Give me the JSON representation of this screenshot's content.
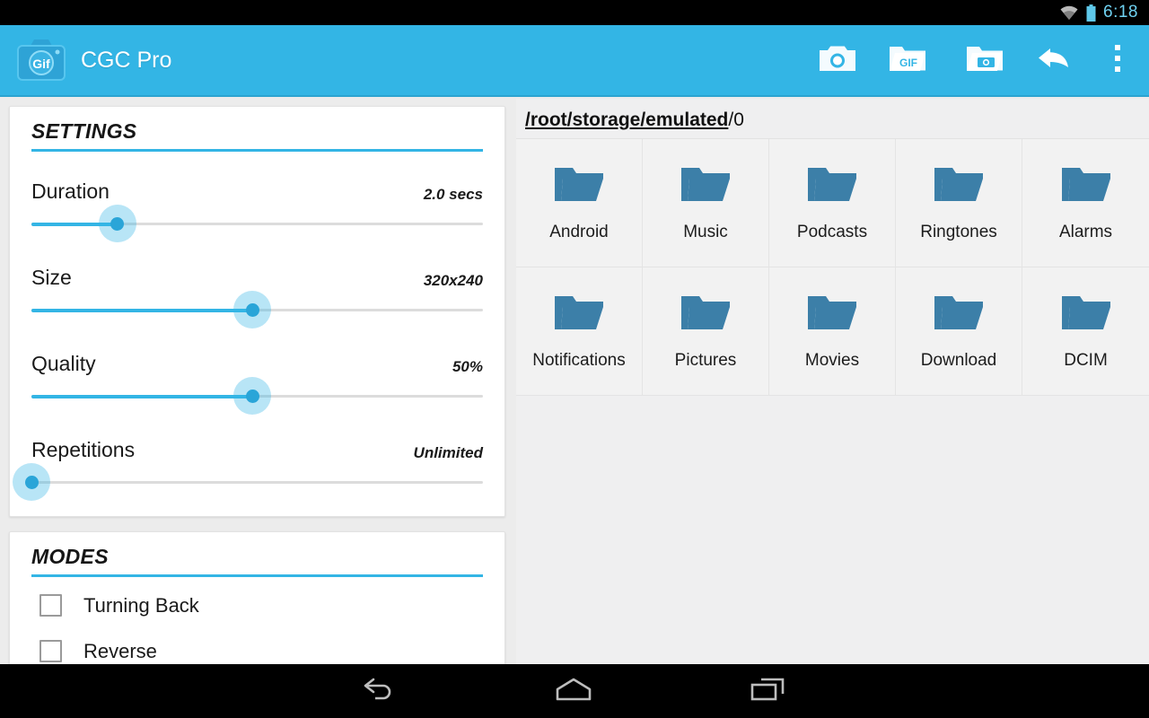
{
  "statusbar": {
    "time": "6:18",
    "wifi_icon": "wifi-icon",
    "battery_icon": "battery-icon"
  },
  "actionbar": {
    "app_icon": "gif-camera-app-icon",
    "title": "CGC Pro",
    "accent_color": "#33b5e5",
    "actions": [
      {
        "name": "camera-button",
        "icon": "camera-icon"
      },
      {
        "name": "gif-folder-button",
        "icon": "gif-folder-icon",
        "icon_label": "GIF"
      },
      {
        "name": "photo-folder-button",
        "icon": "photo-folder-icon"
      },
      {
        "name": "back-button",
        "icon": "reply-arrow-icon"
      },
      {
        "name": "overflow-menu-button",
        "icon": "overflow-menu-icon"
      }
    ]
  },
  "settings": {
    "title": "SETTINGS",
    "items": [
      {
        "label": "Duration",
        "value": "2.0 secs",
        "percent": 19
      },
      {
        "label": "Size",
        "value": "320x240",
        "percent": 49
      },
      {
        "label": "Quality",
        "value": "50%",
        "percent": 49
      },
      {
        "label": "Repetitions",
        "value": "Unlimited",
        "percent": 0
      }
    ]
  },
  "modes": {
    "title": "MODES",
    "items": [
      {
        "label": "Turning Back",
        "checked": false
      },
      {
        "label": "Reverse",
        "checked": false
      }
    ]
  },
  "browser": {
    "path_segments": "/root/storage/emulated",
    "path_tail": "/0",
    "folders": [
      {
        "name": "Android"
      },
      {
        "name": "Music"
      },
      {
        "name": "Podcasts"
      },
      {
        "name": "Ringtones"
      },
      {
        "name": "Alarms"
      },
      {
        "name": "Notifications"
      },
      {
        "name": "Pictures"
      },
      {
        "name": "Movies"
      },
      {
        "name": "Download"
      },
      {
        "name": "DCIM"
      }
    ],
    "folder_icon": "folder-icon",
    "folder_color": "#3c7fa8"
  },
  "navbar": {
    "buttons": [
      {
        "name": "nav-back-button",
        "icon": "back-arrow-icon"
      },
      {
        "name": "nav-home-button",
        "icon": "home-icon"
      },
      {
        "name": "nav-recents-button",
        "icon": "recents-icon"
      }
    ]
  }
}
